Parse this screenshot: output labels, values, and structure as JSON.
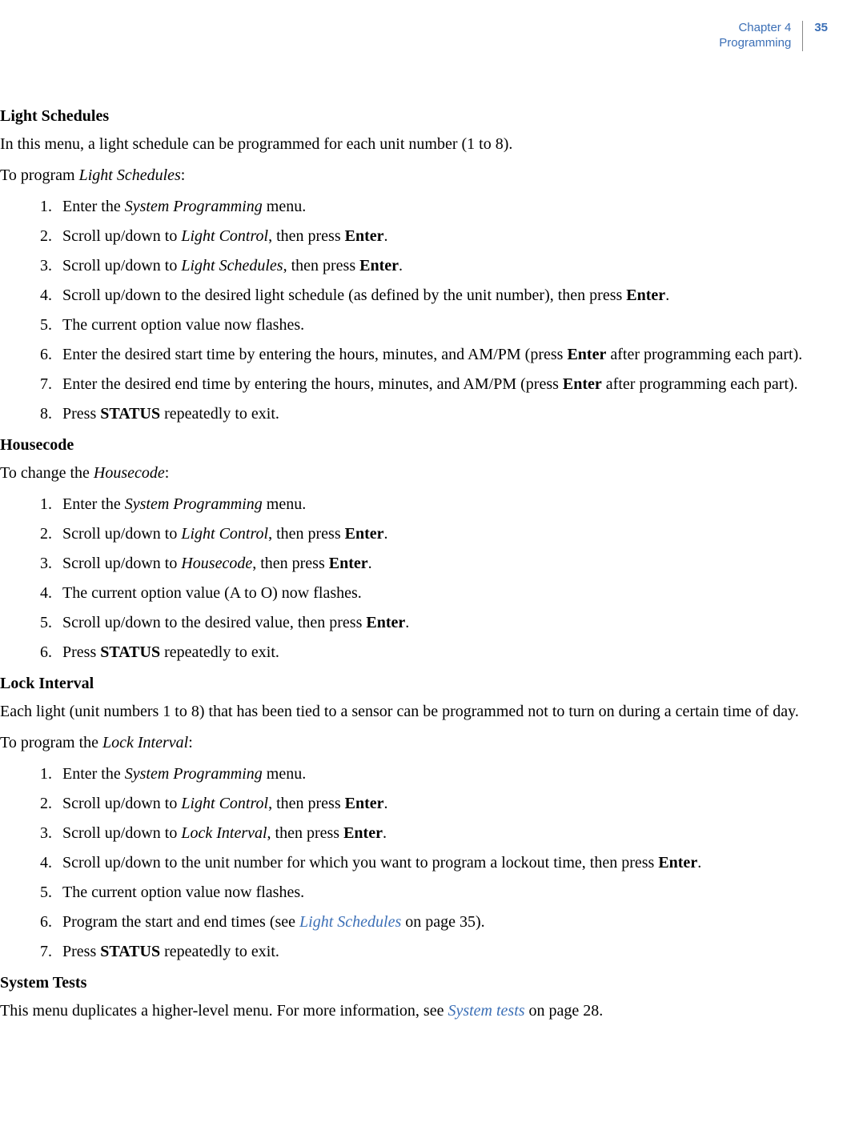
{
  "header": {
    "chapter_line": "Chapter 4",
    "subtitle": "Programming",
    "page_number": "35"
  },
  "section1": {
    "title": "Light Schedules",
    "intro": "In this menu, a light schedule can be programmed for each unit number (1 to 8).",
    "lead_pre": "To program ",
    "lead_em": "Light Schedules",
    "lead_post": ":",
    "steps": {
      "s1_pre": "Enter the ",
      "s1_em": "System Programming",
      "s1_post": " menu.",
      "s2_pre": "Scroll up/down to ",
      "s2_em": "Light Control",
      "s2_mid": ", then press ",
      "s2_b": "Enter",
      "s2_post": ".",
      "s3_pre": "Scroll up/down to ",
      "s3_em": "Light Schedules",
      "s3_mid": ", then press ",
      "s3_b": "Enter",
      "s3_post": ".",
      "s4_pre": "Scroll up/down to the desired light schedule (as defined by the unit number), then press ",
      "s4_b": "Enter",
      "s4_post": ".",
      "s5": "The current option value now flashes.",
      "s6_pre": "Enter the desired start time by entering the hours, minutes, and AM/PM (press ",
      "s6_b": "Enter",
      "s6_post": " after programming each part).",
      "s7_pre": "Enter the desired end time by entering the hours, minutes, and AM/PM (press ",
      "s7_b": "Enter",
      "s7_post": " after programming each part).",
      "s8_pre": "Press ",
      "s8_b": "STATUS",
      "s8_post": " repeatedly to exit."
    }
  },
  "section2": {
    "title": "Housecode",
    "lead_pre": "To change the ",
    "lead_em": "Housecode",
    "lead_post": ":",
    "steps": {
      "s1_pre": "Enter the ",
      "s1_em": "System Programming",
      "s1_post": " menu.",
      "s2_pre": "Scroll up/down to ",
      "s2_em": "Light Control",
      "s2_mid": ", then press ",
      "s2_b": "Enter",
      "s2_post": ".",
      "s3_pre": "Scroll up/down to ",
      "s3_em": "Housecode",
      "s3_mid": ", then press ",
      "s3_b": "Enter",
      "s3_post": ".",
      "s4": "The current option value (A to O) now flashes.",
      "s5_pre": "Scroll up/down to the desired value, then press ",
      "s5_b": "Enter",
      "s5_post": ".",
      "s6_pre": "Press ",
      "s6_b": "STATUS",
      "s6_post": " repeatedly to exit."
    }
  },
  "section3": {
    "title": "Lock Interval",
    "intro": "Each light (unit numbers 1 to 8) that has been tied to a sensor can be programmed not to turn on during a certain time of day.",
    "lead_pre": "To program the ",
    "lead_em": "Lock Interval",
    "lead_post": ":",
    "steps": {
      "s1_pre": "Enter the ",
      "s1_em": "System Programming",
      "s1_post": " menu.",
      "s2_pre": "Scroll up/down to ",
      "s2_em": "Light Control",
      "s2_mid": ", then press ",
      "s2_b": "Enter",
      "s2_post": ".",
      "s3_pre": "Scroll up/down to ",
      "s3_em": "Lock Interval",
      "s3_mid": ", then press ",
      "s3_b": "Enter",
      "s3_post": ".",
      "s4_pre": "Scroll up/down to the unit number for which you want to program a lockout time, then press ",
      "s4_b": "Enter",
      "s4_post": ".",
      "s5": "The current option value now flashes.",
      "s6_pre": "Program the start and end times (see ",
      "s6_link": "Light Schedules",
      "s6_post": " on page 35).",
      "s7_pre": "Press ",
      "s7_b": "STATUS",
      "s7_post": " repeatedly to exit."
    }
  },
  "section4": {
    "title": "System Tests",
    "body_pre": "This menu duplicates a higher-level menu. For more information, see ",
    "body_link": "System tests",
    "body_post": " on page 28."
  }
}
